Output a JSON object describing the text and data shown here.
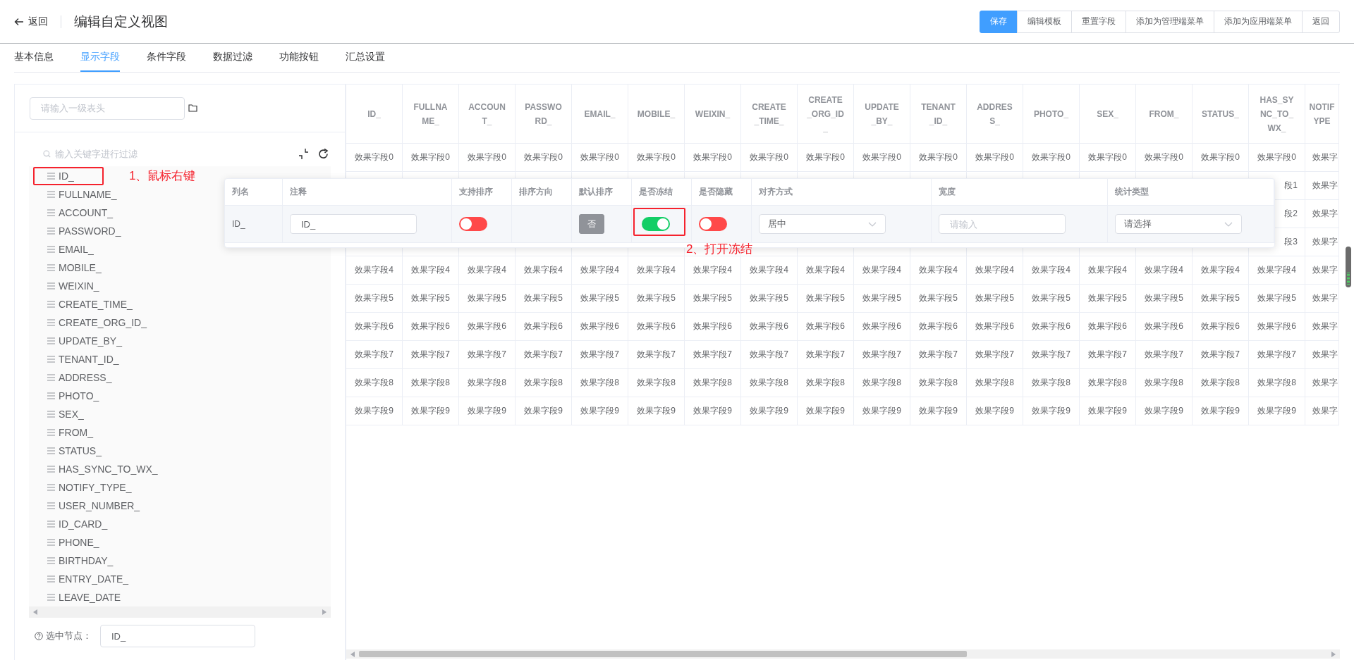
{
  "header": {
    "back": "返回",
    "title": "编辑自定义视图",
    "buttons": [
      {
        "label": "保存",
        "kind": "primary"
      },
      {
        "label": "编辑模板",
        "kind": "default"
      },
      {
        "label": "重置字段",
        "kind": "default"
      },
      {
        "label": "添加为管理端菜单",
        "kind": "default"
      },
      {
        "label": "添加为应用端菜单",
        "kind": "default"
      },
      {
        "label": "返回",
        "kind": "default"
      }
    ]
  },
  "tabs": [
    {
      "label": "基本信息",
      "selected": false
    },
    {
      "label": "显示字段",
      "selected": true
    },
    {
      "label": "条件字段",
      "selected": false
    },
    {
      "label": "数据过滤",
      "selected": false
    },
    {
      "label": "功能按钮",
      "selected": false
    },
    {
      "label": "汇总设置",
      "selected": false
    }
  ],
  "tree_panel": {
    "header_input": {
      "placeholder": "请输入一级表头"
    },
    "filter": {
      "placeholder": "输入关键字进行过滤"
    },
    "items": [
      {
        "label": "ID_",
        "annotation": "1、鼠标右键"
      },
      {
        "label": "FULLNAME_"
      },
      {
        "label": "ACCOUNT_"
      },
      {
        "label": "PASSWORD_"
      },
      {
        "label": "EMAIL_"
      },
      {
        "label": "MOBILE_"
      },
      {
        "label": "WEIXIN_"
      },
      {
        "label": "CREATE_TIME_"
      },
      {
        "label": "CREATE_ORG_ID_"
      },
      {
        "label": "UPDATE_BY_"
      },
      {
        "label": "TENANT_ID_"
      },
      {
        "label": "ADDRESS_"
      },
      {
        "label": "PHOTO_"
      },
      {
        "label": "SEX_"
      },
      {
        "label": "FROM_"
      },
      {
        "label": "STATUS_"
      },
      {
        "label": "HAS_SYNC_TO_WX_"
      },
      {
        "label": "NOTIFY_TYPE_"
      },
      {
        "label": "USER_NUMBER_"
      },
      {
        "label": "ID_CARD_"
      },
      {
        "label": "PHONE_"
      },
      {
        "label": "BIRTHDAY_"
      },
      {
        "label": "ENTRY_DATE_"
      },
      {
        "label": "LEAVE_DATE"
      }
    ],
    "selected_node": {
      "label": "选中节点：",
      "value": "ID_"
    }
  },
  "table": {
    "columns": [
      "ID_",
      "FULLNAME_",
      "ACCOUNT_",
      "PASSWORD_",
      "EMAIL_",
      "MOBILE_",
      "WEIXIN_",
      "CREATE_TIME_",
      "CREATE_ORG_ID_",
      "UPDATE_BY_",
      "TENANT_ID_",
      "ADDRESS_",
      "PHOTO_",
      "SEX_",
      "FROM_",
      "STATUS_",
      "HAS_SYNC_TO_WX_",
      "NOTIF YPE"
    ],
    "rows": [
      {
        "cells": [
          "效果字段0",
          "效果字段0",
          "效果字段0",
          "效果字段0",
          "效果字段0",
          "效果字段0",
          "效果字段0",
          "效果字段0",
          "效果字段0",
          "效果字段0",
          "效果字段0",
          "效果字段0",
          "效果字段0",
          "效果字段0",
          "效果字段0",
          "效果字段0",
          "效果字段0",
          "效果字"
        ]
      },
      {
        "cells": [
          null,
          null,
          null,
          null,
          null,
          null,
          null,
          null,
          null,
          null,
          null,
          null,
          null,
          null,
          null,
          null,
          "段1",
          "效果字"
        ]
      },
      {
        "cells": [
          null,
          null,
          null,
          null,
          null,
          null,
          null,
          null,
          null,
          null,
          null,
          null,
          null,
          null,
          null,
          null,
          "段2",
          "效果字"
        ]
      },
      {
        "cells": [
          null,
          null,
          null,
          null,
          null,
          null,
          null,
          null,
          null,
          null,
          null,
          null,
          null,
          null,
          null,
          null,
          "段3",
          "效果字"
        ]
      },
      {
        "cells": [
          "效果字段4",
          "效果字段4",
          "效果字段4",
          "效果字段4",
          "效果字段4",
          "效果字段4",
          "效果字段4",
          "效果字段4",
          "效果字段4",
          "效果字段4",
          "效果字段4",
          "效果字段4",
          "效果字段4",
          "效果字段4",
          "效果字段4",
          "效果字段4",
          "效果字段4",
          "效果字"
        ]
      },
      {
        "cells": [
          "效果字段5",
          "效果字段5",
          "效果字段5",
          "效果字段5",
          "效果字段5",
          "效果字段5",
          "效果字段5",
          "效果字段5",
          "效果字段5",
          "效果字段5",
          "效果字段5",
          "效果字段5",
          "效果字段5",
          "效果字段5",
          "效果字段5",
          "效果字段5",
          "效果字段5",
          "效果字"
        ]
      },
      {
        "cells": [
          "效果字段6",
          "效果字段6",
          "效果字段6",
          "效果字段6",
          "效果字段6",
          "效果字段6",
          "效果字段6",
          "效果字段6",
          "效果字段6",
          "效果字段6",
          "效果字段6",
          "效果字段6",
          "效果字段6",
          "效果字段6",
          "效果字段6",
          "效果字段6",
          "效果字段6",
          "效果字"
        ]
      },
      {
        "cells": [
          "效果字段7",
          "效果字段7",
          "效果字段7",
          "效果字段7",
          "效果字段7",
          "效果字段7",
          "效果字段7",
          "效果字段7",
          "效果字段7",
          "效果字段7",
          "效果字段7",
          "效果字段7",
          "效果字段7",
          "效果字段7",
          "效果字段7",
          "效果字段7",
          "效果字段7",
          "效果字"
        ]
      },
      {
        "cells": [
          "效果字段8",
          "效果字段8",
          "效果字段8",
          "效果字段8",
          "效果字段8",
          "效果字段8",
          "效果字段8",
          "效果字段8",
          "效果字段8",
          "效果字段8",
          "效果字段8",
          "效果字段8",
          "效果字段8",
          "效果字段8",
          "效果字段8",
          "效果字段8",
          "效果字段8",
          "效果字"
        ]
      },
      {
        "cells": [
          "效果字段9",
          "效果字段9",
          "效果字段9",
          "效果字段9",
          "效果字段9",
          "效果字段9",
          "效果字段9",
          "效果字段9",
          "效果字段9",
          "效果字段9",
          "效果字段9",
          "效果字段9",
          "效果字段9",
          "效果字段9",
          "效果字段9",
          "效果字段9",
          "效果字段9",
          "效果字"
        ]
      }
    ]
  },
  "column_settings": {
    "columns": [
      "列名",
      "注释",
      "支持排序",
      "排序方向",
      "默认排序",
      "是否冻结",
      "是否隐藏",
      "对齐方式",
      "宽度",
      "统计类型"
    ],
    "row": {
      "name": "ID_",
      "comment": "ID_",
      "sortable": {
        "on": false
      },
      "default_sort": "否",
      "frozen": {
        "on": true,
        "annotation": "2、打开冻结"
      },
      "hidden": {
        "on": false
      },
      "align": {
        "value": "居中"
      },
      "width": {
        "placeholder": "请输入"
      },
      "summary": {
        "placeholder": "请选择"
      }
    }
  }
}
